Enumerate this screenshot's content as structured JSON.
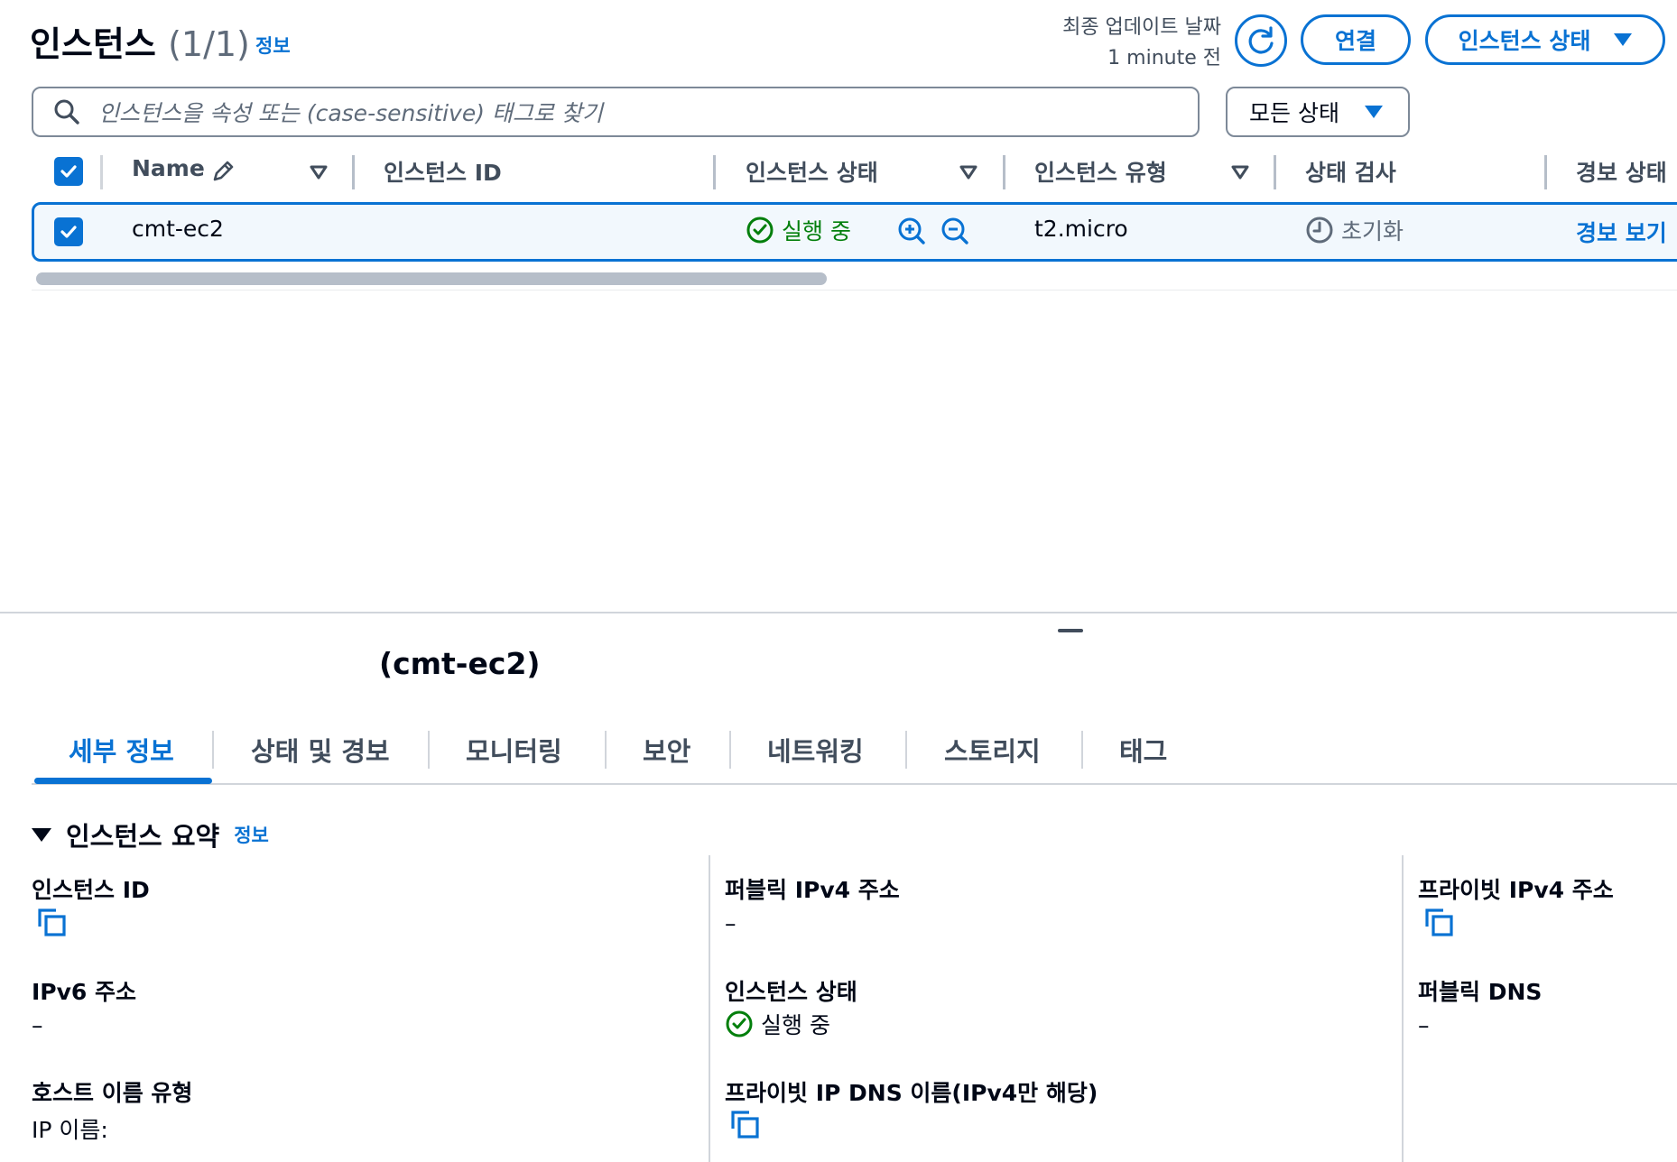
{
  "header": {
    "title": "인스턴스",
    "count": "(1/1)",
    "info_label": "정보",
    "last_updated_label": "최종 업데이트 날짜",
    "last_updated_value": "1 minute 전",
    "connect_label": "연결",
    "instance_state_label": "인스턴스 상태"
  },
  "search": {
    "placeholder": "인스턴스을 속성 또는 (case-sensitive) 태그로 찾기",
    "state_filter": "모든 상태"
  },
  "table": {
    "columns": [
      "Name",
      "인스턴스 ID",
      "인스턴스 상태",
      "인스턴스 유형",
      "상태 검사",
      "경보 상태"
    ],
    "rows": [
      {
        "name": "cmt-ec2",
        "instance_id": "",
        "state": "실행 중",
        "type": "t2.micro",
        "status_check": "초기화",
        "alarm": "경보 보기"
      }
    ]
  },
  "detail": {
    "title": "(cmt-ec2)",
    "tabs": [
      "세부 정보",
      "상태 및 경보",
      "모니터링",
      "보안",
      "네트워킹",
      "스토리지",
      "태그"
    ],
    "section_title": "인스턴스 요약",
    "section_info": "정보",
    "fields": {
      "instance_id_label": "인스턴스 ID",
      "public_ipv4_label": "퍼블릭 IPv4 주소",
      "public_ipv4_value": "–",
      "private_ipv4_label": "프라이빗 IPv4 주소",
      "ipv6_label": "IPv6 주소",
      "ipv6_value": "–",
      "instance_state_label": "인스턴스 상태",
      "instance_state_value": "실행 중",
      "public_dns_label": "퍼블릭 DNS",
      "public_dns_value": "–",
      "hostname_type_label": "호스트 이름 유형",
      "hostname_type_value": "IP 이름:",
      "private_dns_label": "프라이빗 IP DNS 이름(IPv4만 해당)"
    }
  },
  "colors": {
    "accent": "#0972d3",
    "success": "#037f0c",
    "text": "#000716",
    "muted": "#5f6b7a"
  }
}
